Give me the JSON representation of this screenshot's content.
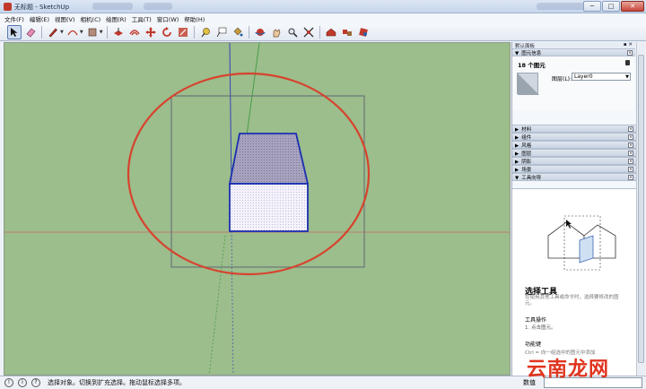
{
  "window": {
    "title": "无标题 - SketchUp",
    "buttons": [
      "─",
      "□",
      "✕"
    ]
  },
  "menu": [
    "文件(F)",
    "编辑(E)",
    "视图(V)",
    "相机(C)",
    "绘图(R)",
    "工具(T)",
    "窗口(W)",
    "帮助(H)"
  ],
  "toolbar": {
    "tools": [
      "select-tool",
      "eraser-tool",
      "line-tool",
      "arc-tool",
      "shape-tool",
      "push-pull-tool",
      "offset-tool",
      "move-tool",
      "rotate-tool",
      "scale-tool",
      "tape-measure-tool",
      "text-tool",
      "paint-bucket-tool",
      "orbit-tool",
      "pan-tool",
      "zoom-tool",
      "zoom-extents-tool",
      "warehouse-tool",
      "components-tool",
      "extension-tool"
    ]
  },
  "panel": {
    "header": "默认面板",
    "entity_info": {
      "title": "图元信息",
      "count": "18 个图元",
      "layer_label": "图层(L):",
      "layer_value": "Layer0"
    },
    "trays": [
      "材料",
      "组件",
      "风格",
      "图层",
      "阴影",
      "场景"
    ],
    "instructor": {
      "title": "工具向导",
      "tool_name": "选择工具",
      "description": "在使用其他工具或命令时，选择要修改的图元。",
      "ops_title": "工具操作",
      "ops_1": "1.  点击图元。",
      "keys_title": "功能键",
      "keys_1": "Ctrl = 向一组选中的图元中添加"
    }
  },
  "status": {
    "text": "选择对象。切换到扩充选择。拖动鼠标选择多项。",
    "measure_label": "数值",
    "measure_value": ""
  },
  "watermark": "云南龙网",
  "colors": {
    "ground": "#9cbd8c",
    "ellipse": "#d7432e",
    "edge": "#1a2fb0",
    "roof": "#a6a2bf"
  }
}
